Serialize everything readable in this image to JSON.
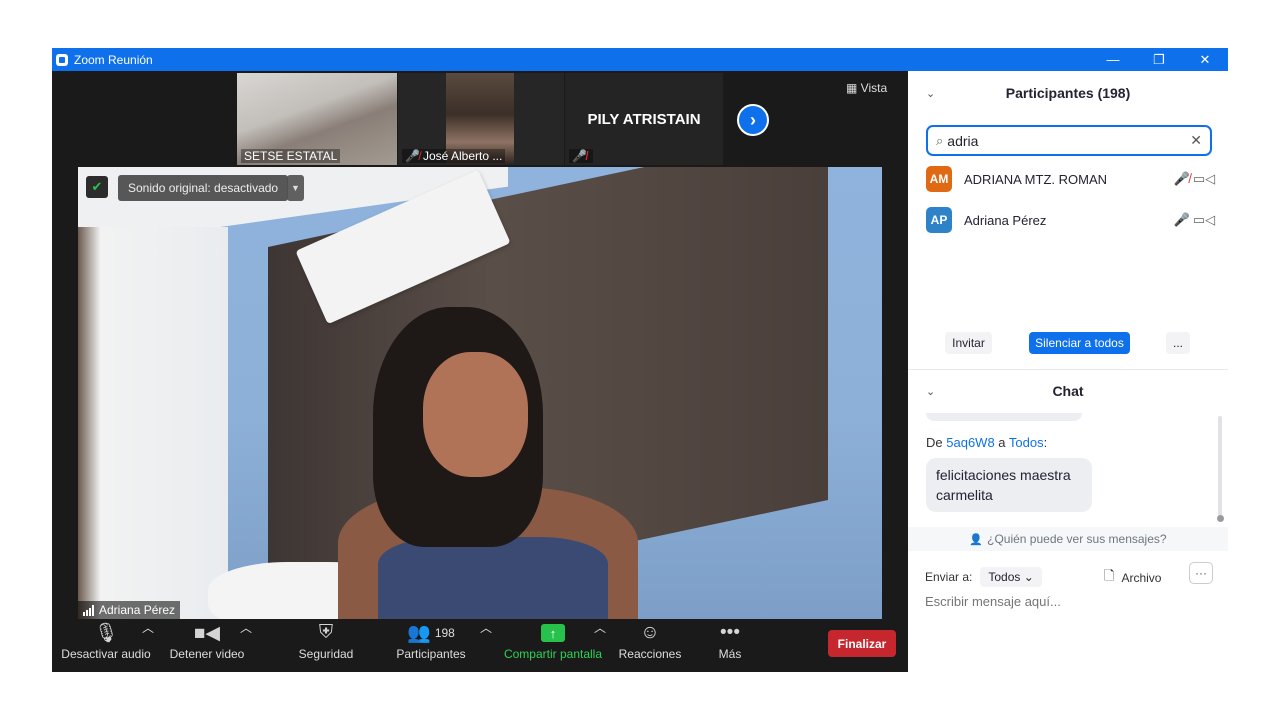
{
  "window": {
    "title": "Zoom Reunión",
    "minimize": "—",
    "restore": "❐",
    "close": "✕"
  },
  "gallery": {
    "thumbnails": [
      {
        "label": "SETSE ESTATAL",
        "muted": false
      },
      {
        "label": "José Alberto ...",
        "muted": true
      },
      {
        "label": "PILY ATRISTAIN",
        "muted": true
      }
    ],
    "view_label": "Vista",
    "next_icon": "chevron-right-icon"
  },
  "main_video": {
    "sound_label": "Sonido original: desactivado",
    "name_tag": "Adriana Pérez"
  },
  "toolbar": {
    "mute_label": "Desactivar audio",
    "video_label": "Detener video",
    "security_label": "Seguridad",
    "participants_label": "Participantes",
    "participants_count": "198",
    "share_label": "Compartir pantalla",
    "reactions_label": "Reacciones",
    "more_label": "Más",
    "end_label": "Finalizar"
  },
  "participants_panel": {
    "title": "Participantes (198)",
    "search_value": "adria",
    "rows": [
      {
        "initials": "AM",
        "name": "ADRIANA MTZ. ROMAN",
        "color": "#e06a14",
        "mic_muted": true
      },
      {
        "initials": "AP",
        "name": "Adriana Pérez",
        "color": "#2d82c8",
        "mic_muted": false
      }
    ],
    "invite_label": "Invitar",
    "mute_all_label": "Silenciar a todos",
    "more_label": "..."
  },
  "chat_panel": {
    "title": "Chat",
    "message": {
      "from_prefix": "De",
      "sender": "5aq6W8",
      "to_word": "a",
      "recipient": "Todos",
      "suffix": ":",
      "text": "felicitaciones maestra carmelita"
    },
    "who_sees": "¿Quién puede ver sus mensajes?",
    "send_to_label": "Enviar a:",
    "send_to_value": "Todos",
    "file_label": "Archivo",
    "more_label": "···",
    "input_placeholder": "Escribir mensaje aquí..."
  },
  "colors": {
    "accent": "#0e71eb",
    "danger": "#c6262e",
    "share_green": "#27c24c"
  }
}
